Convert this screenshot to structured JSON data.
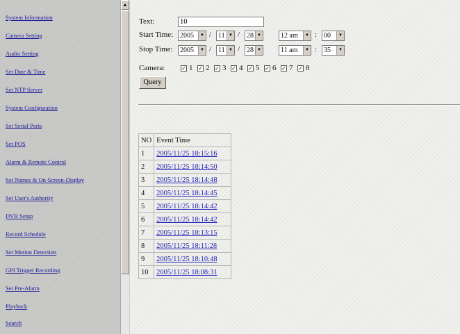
{
  "sidebar": {
    "items": [
      {
        "label": "System Information"
      },
      {
        "label": "Camera Setting"
      },
      {
        "label": "Audio Setting"
      },
      {
        "label": "Set Date & Time"
      },
      {
        "label": "Set NTP Server"
      },
      {
        "label": "System Configuration"
      },
      {
        "label": "Set Serial Ports"
      },
      {
        "label": "Set POS"
      },
      {
        "label": "Alarm & Remote Control"
      },
      {
        "label": "Set Names & On-Screen-Display"
      },
      {
        "label": "Set User's Authority"
      },
      {
        "label": "DVR Setup"
      },
      {
        "label": "Record Schedule"
      },
      {
        "label": "Set Motion Detection"
      },
      {
        "label": "GPI Trigger Recording"
      },
      {
        "label": "Set Pre-Alarm"
      },
      {
        "label": "Playback"
      },
      {
        "label": "Search"
      }
    ]
  },
  "scrollbar": {
    "up_icon": "▲"
  },
  "form": {
    "text_label": "Text:",
    "text_value": "10",
    "start_label": "Start Time:",
    "start": {
      "year": "2005",
      "month": "11",
      "day": "28",
      "hour": "12 am",
      "minute": "00"
    },
    "stop_label": "Stop Time:",
    "stop": {
      "year": "2005",
      "month": "11",
      "day": "28",
      "hour": "11 am",
      "minute": "35"
    },
    "date_sep": "/",
    "time_sep": ":",
    "camera_label": "Camera:",
    "cameras": [
      {
        "num": "1",
        "checked": true
      },
      {
        "num": "2",
        "checked": true
      },
      {
        "num": "3",
        "checked": true
      },
      {
        "num": "4",
        "checked": true
      },
      {
        "num": "5",
        "checked": true
      },
      {
        "num": "6",
        "checked": true
      },
      {
        "num": "7",
        "checked": true
      },
      {
        "num": "8",
        "checked": true
      }
    ],
    "query_label": "Query",
    "dropdown_arrow": "▼",
    "check_mark": "✓"
  },
  "results": {
    "headers": [
      "NO",
      "Event Time"
    ],
    "rows": [
      {
        "no": "1",
        "time": "2005/11/25 18:15:16"
      },
      {
        "no": "2",
        "time": "2005/11/25 18:14:50"
      },
      {
        "no": "3",
        "time": "2005/11/25 18:14:48"
      },
      {
        "no": "4",
        "time": "2005/11/25 18:14:45"
      },
      {
        "no": "5",
        "time": "2005/11/25 18:14:42"
      },
      {
        "no": "6",
        "time": "2005/11/25 18:14:42"
      },
      {
        "no": "7",
        "time": "2005/11/25 18:13:15"
      },
      {
        "no": "8",
        "time": "2005/11/25 18:11:28"
      },
      {
        "no": "9",
        "time": "2005/11/25 18:10:48"
      },
      {
        "no": "10",
        "time": "2005/11/25 18:08:31"
      }
    ]
  }
}
